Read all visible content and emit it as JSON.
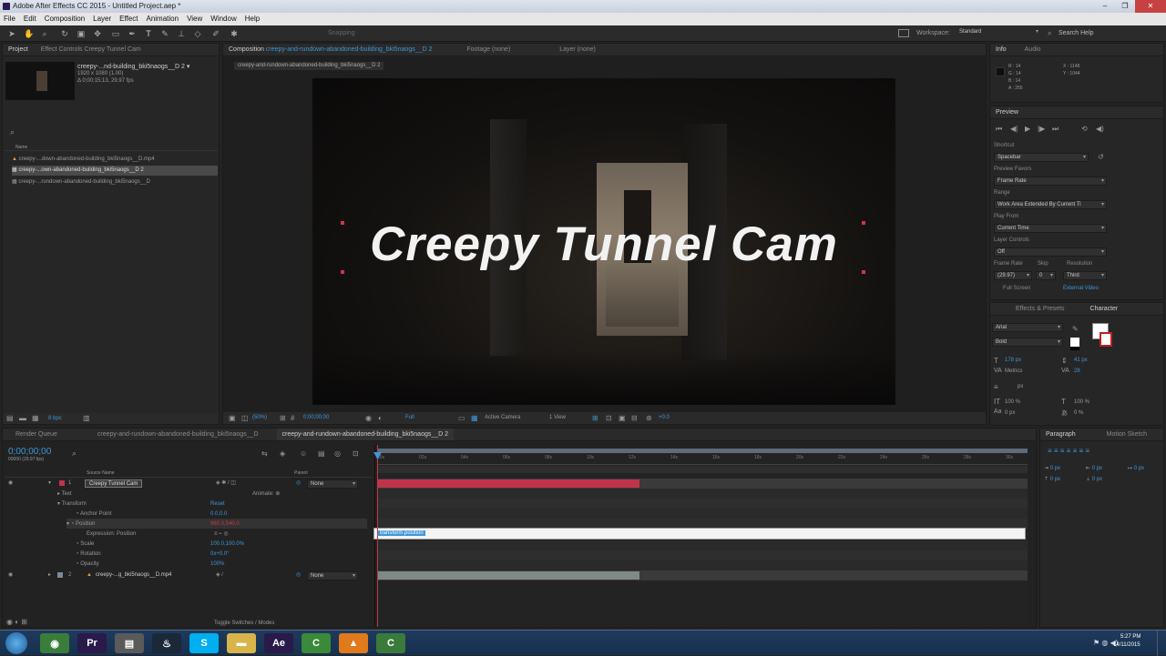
{
  "window": {
    "title": "Adobe After Effects CC 2015 - Untitled Project.aep *",
    "controls": [
      "–",
      "❐",
      "✕"
    ]
  },
  "menu": [
    "File",
    "Edit",
    "Composition",
    "Layer",
    "Effect",
    "Animation",
    "View",
    "Window",
    "Help"
  ],
  "toolbar": {
    "snapping": "Snapping",
    "workspace_label": "Workspace:",
    "workspace_value": "Standard",
    "search": "Search Help"
  },
  "project": {
    "tab_project": "Project",
    "tab_effects": "Effect Controls Creepy Tunnel Cam",
    "selected_name": "creepy-...nd-building_bki5naogs__D 2 ▾",
    "selected_info": "1920 x 1080 (1.00)",
    "selected_info2": "Δ 0;00;15;13, 29.97 fps",
    "col_name": "Name",
    "items": [
      "creepy-...down-abandoned-building_bki5naogs__D.mp4",
      "creepy-...own-abandoned-building_bki5naogs__D 2",
      "creepy-...rundown-abandoned-building_bki5naogs__D"
    ],
    "bpc": "8 bpc"
  },
  "comp": {
    "tab_comp": "Composition",
    "comp_name": "creepy-and-rundown-abandoned-building_bki5naogs__D 2",
    "tab_footage": "Footage (none)",
    "tab_layer": "Layer (none)",
    "breadcrumb": "creepy-and-rundown-abandoned-building_bki5naogs__D 2",
    "title_text": "Creepy Tunnel Cam",
    "zoom": "(50%)",
    "time": "0;00;00;00",
    "resolution": "Full",
    "camera": "Active Camera",
    "views": "1 View",
    "exposure": "+0.0"
  },
  "info": {
    "tab_info": "Info",
    "tab_audio": "Audio",
    "r": "R : 14",
    "g": "G : 14",
    "b": "B : 14",
    "a": "A : 255",
    "x": "X : 1148",
    "y": "Y : 1044"
  },
  "preview": {
    "title": "Preview",
    "shortcut_label": "Shortcut",
    "shortcut": "Spacebar",
    "favors_label": "Preview Favors",
    "favors": "Frame Rate",
    "range_label": "Range",
    "range": "Work Area Extended By Current Ti",
    "playfrom_label": "Play From",
    "playfrom": "Current Time",
    "layercontrols_label": "Layer Controls",
    "layercontrols": "Off",
    "framerate_label": "Frame Rate",
    "skip_label": "Skip",
    "resolution_label": "Resolution",
    "framerate": "(29.97)",
    "skip": "0",
    "resolution": "Third",
    "fullscreen": "Full Screen",
    "external": "External Video"
  },
  "character": {
    "tab_effects": "Effects & Presets",
    "tab_character": "Character",
    "font": "Arial",
    "style": "Bold",
    "size": "178 px",
    "leading": "41 px",
    "kerning": "Metrics",
    "tracking": "28",
    "stroke": "px",
    "vscale": "100 %",
    "hscale": "100 %",
    "baseline": "0 px",
    "tsume": "0 %"
  },
  "timeline": {
    "tab_render": "Render Queue",
    "tab_comp1": "creepy-and-rundown-abandoned-building_bki5naogs__D",
    "tab_comp2": "creepy-and-rundown-abandoned-building_bki5naogs__D 2",
    "timecode": "0;00;00;00",
    "fps": "00000 (29.97 fps)",
    "col_source": "Source Name",
    "col_parent": "Parent",
    "layers": [
      {
        "num": "1",
        "name": "Creepy Tunnel Cam",
        "parent": "None"
      },
      {
        "num": "2",
        "name": "creepy-...g_bki5naogs__D.mp4",
        "parent": "None"
      }
    ],
    "props": [
      {
        "name": "Text",
        "value": "",
        "extra": "Animate: ⊕"
      },
      {
        "name": "Transform",
        "value": "Reset",
        "extra": ""
      },
      {
        "name": "Anchor Point",
        "value": "0.0,0.0",
        "extra": ""
      },
      {
        "name": "Position",
        "value": "960.0,540.0",
        "extra": ""
      },
      {
        "name": "Expression: Position",
        "value": "",
        "extra": ""
      },
      {
        "name": "Scale",
        "value": "100.0,100.0%",
        "extra": ""
      },
      {
        "name": "Rotation",
        "value": "0x+0.0°",
        "extra": ""
      },
      {
        "name": "Opacity",
        "value": "100%",
        "extra": ""
      }
    ],
    "ruler": [
      "00s",
      "02s",
      "04s",
      "06s",
      "08s",
      "10s",
      "12s",
      "14s",
      "16s",
      "18s",
      "20s",
      "22s",
      "24s",
      "26s",
      "28s",
      "30s"
    ],
    "expression": "transform.position",
    "toggle": "Toggle Switches / Modes"
  },
  "paragraph": {
    "tab_paragraph": "Paragraph",
    "tab_motion": "Motion Sketch",
    "indent1": "0 px",
    "indent2": "0 px",
    "indent3": "0 px",
    "space1": "0 px",
    "space2": "0 px"
  },
  "taskbar": {
    "time": "5:27 PM",
    "date": "14/11/2015",
    "apps": [
      {
        "name": "chrome",
        "label": "◉",
        "color": "#3a7d3a"
      },
      {
        "name": "premiere",
        "label": "Pr",
        "color": "#2a1a4a"
      },
      {
        "name": "explorer-app",
        "label": "▤",
        "color": "#5a5a5a"
      },
      {
        "name": "steam",
        "label": "♨",
        "color": "#1b2838"
      },
      {
        "name": "skype",
        "label": "S",
        "color": "#00aff0"
      },
      {
        "name": "folder",
        "label": "▬",
        "color": "#d9b44a"
      },
      {
        "name": "after-effects",
        "label": "Ae",
        "color": "#2a1a4a"
      },
      {
        "name": "camtasia",
        "label": "C",
        "color": "#3a8a3a"
      },
      {
        "name": "vlc",
        "label": "▲",
        "color": "#e07a1a"
      },
      {
        "name": "camtasia-recorder",
        "label": "C",
        "color": "#3a7a3a"
      }
    ]
  }
}
